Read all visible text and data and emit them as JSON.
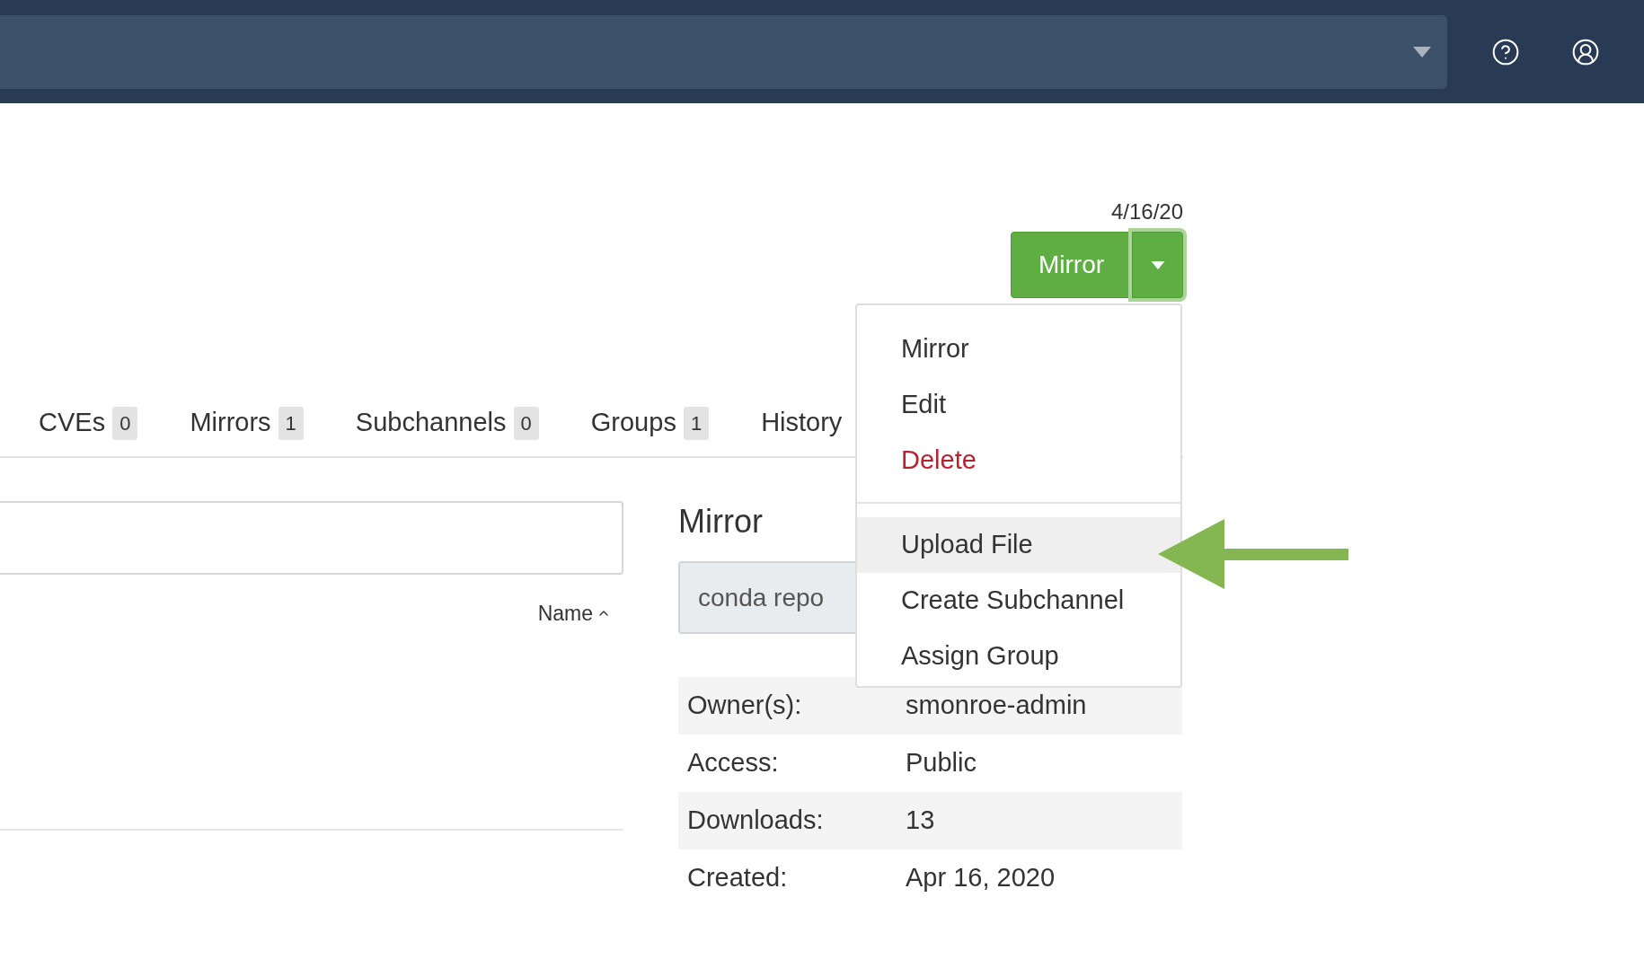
{
  "header": {
    "date": "4/16/20",
    "split_button": {
      "label": "Mirror",
      "menu_open": true
    }
  },
  "tabs": [
    {
      "label": "CVEs",
      "count": "0",
      "selected": false
    },
    {
      "label": "Mirrors",
      "count": "1",
      "selected": false
    },
    {
      "label": "Subchannels",
      "count": "0",
      "selected": false
    },
    {
      "label": "Groups",
      "count": "1",
      "selected": false
    },
    {
      "label": "History",
      "selected": false
    }
  ],
  "list": {
    "sort_label": "Name",
    "sort_ascending": true
  },
  "details": {
    "title": "Mirror",
    "field_value": "conda repo",
    "rows": [
      {
        "label": "Owner(s):",
        "value": "smonroe-admin"
      },
      {
        "label": "Access:",
        "value": "Public"
      },
      {
        "label": "Downloads:",
        "value": "13"
      },
      {
        "label": "Created:",
        "value": "Apr 16, 2020"
      }
    ]
  },
  "menu": {
    "items": [
      {
        "kind": "item",
        "label": "Mirror",
        "highlighted": false
      },
      {
        "kind": "item",
        "label": "Edit",
        "highlighted": false
      },
      {
        "kind": "danger",
        "label": "Delete",
        "highlighted": false
      },
      {
        "kind": "divider"
      },
      {
        "kind": "item",
        "label": "Upload File",
        "highlighted": true
      },
      {
        "kind": "item",
        "label": "Create Subchannel",
        "highlighted": false
      },
      {
        "kind": "item",
        "label": "Assign Group",
        "highlighted": false
      }
    ]
  }
}
